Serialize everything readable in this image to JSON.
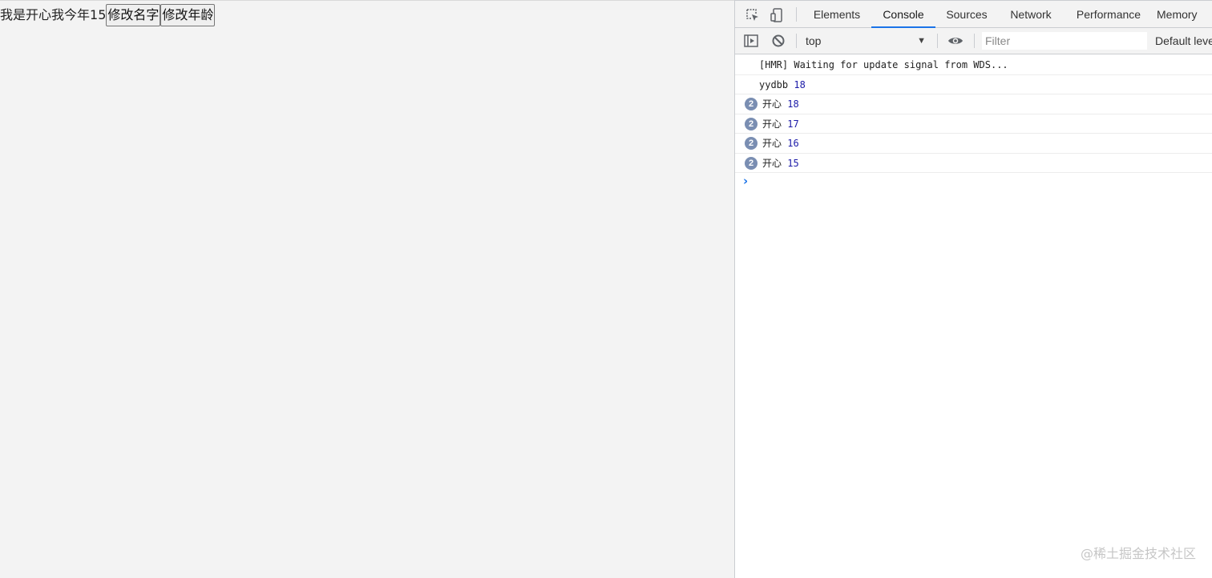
{
  "page": {
    "name_prefix": "我是",
    "name": "开心",
    "age_prefix": "我今年",
    "age": "15",
    "change_name_button": "修改名字",
    "change_age_button": "修改年龄"
  },
  "devtools": {
    "tabs": [
      {
        "label": "Elements",
        "active": false
      },
      {
        "label": "Console",
        "active": true
      },
      {
        "label": "Sources",
        "active": false
      },
      {
        "label": "Network",
        "active": false
      },
      {
        "label": "Performance",
        "active": false
      },
      {
        "label": "Memory",
        "active": false
      }
    ],
    "toolbar": {
      "context": "top",
      "filter_placeholder": "Filter",
      "levels_label": "Default levels"
    },
    "console": {
      "lines": [
        {
          "text": "[HMR] Waiting for update signal from WDS...",
          "value": "",
          "count": ""
        },
        {
          "text": "yydbb",
          "value": "18",
          "count": ""
        },
        {
          "text": "开心",
          "value": "18",
          "count": "2"
        },
        {
          "text": "开心",
          "value": "17",
          "count": "2"
        },
        {
          "text": "开心",
          "value": "16",
          "count": "2"
        },
        {
          "text": "开心",
          "value": "15",
          "count": "2"
        }
      ]
    }
  },
  "watermark": "@稀土掘金技术社区",
  "colors": {
    "accent": "#1a73e8",
    "number": "#1c1ba8",
    "badge": "#7a8eb2"
  }
}
